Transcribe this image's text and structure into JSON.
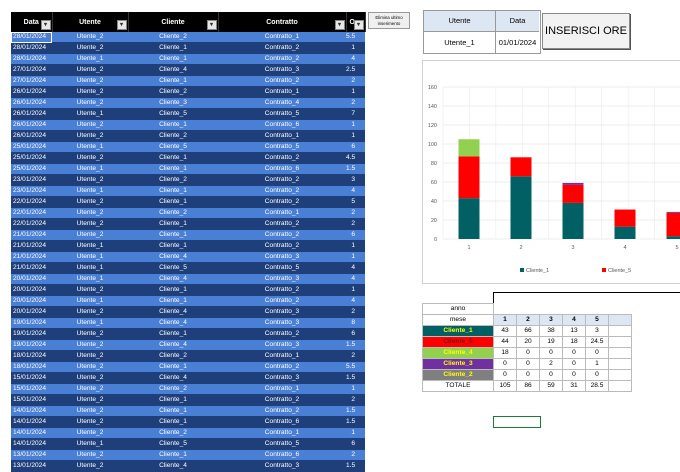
{
  "columns": [
    "Data",
    "Utente",
    "Cliente",
    "Contratto",
    "Ore"
  ],
  "rows": [
    [
      "28/01/2024",
      "Utente_2",
      "Cliente_2",
      "Contratto_1",
      "5.5"
    ],
    [
      "28/01/2024",
      "Utente_2",
      "Cliente_1",
      "Contratto_2",
      "1"
    ],
    [
      "28/01/2024",
      "Utente_1",
      "Cliente_1",
      "Contratto_2",
      "4"
    ],
    [
      "27/01/2024",
      "Utente_2",
      "Cliente_4",
      "Contratto_3",
      "2.5"
    ],
    [
      "27/01/2024",
      "Utente_2",
      "Cliente_1",
      "Contratto_2",
      "2"
    ],
    [
      "26/01/2024",
      "Utente_2",
      "Cliente_2",
      "Contratto_1",
      "1"
    ],
    [
      "26/01/2024",
      "Utente_2",
      "Cliente_3",
      "Contratto_4",
      "2"
    ],
    [
      "26/01/2024",
      "Utente_1",
      "Cliente_5",
      "Contratto_5",
      "7"
    ],
    [
      "26/01/2024",
      "Utente_2",
      "Cliente_1",
      "Contratto_6",
      "1"
    ],
    [
      "26/01/2024",
      "Utente_2",
      "Cliente_2",
      "Contratto_1",
      "1"
    ],
    [
      "25/01/2024",
      "Utente_1",
      "Cliente_5",
      "Contratto_5",
      "6"
    ],
    [
      "25/01/2024",
      "Utente_2",
      "Cliente_1",
      "Contratto_2",
      "4.5"
    ],
    [
      "25/01/2024",
      "Utente_1",
      "Cliente_1",
      "Contratto_6",
      "1.5"
    ],
    [
      "23/01/2024",
      "Utente_2",
      "Cliente_2",
      "Contratto_2",
      "3"
    ],
    [
      "23/01/2024",
      "Utente_1",
      "Cliente_1",
      "Contratto_2",
      "4"
    ],
    [
      "22/01/2024",
      "Utente_2",
      "Cliente_1",
      "Contratto_2",
      "5"
    ],
    [
      "22/01/2024",
      "Utente_2",
      "Cliente_2",
      "Contratto_1",
      "2"
    ],
    [
      "22/01/2024",
      "Utente_2",
      "Cliente_1",
      "Contratto_2",
      "2"
    ],
    [
      "21/01/2024",
      "Utente_2",
      "Cliente_1",
      "Contratto_2",
      "6"
    ],
    [
      "21/01/2024",
      "Utente_1",
      "Cliente_1",
      "Contratto_2",
      "1"
    ],
    [
      "21/01/2024",
      "Utente_1",
      "Cliente_4",
      "Contratto_3",
      "1"
    ],
    [
      "21/01/2024",
      "Utente_1",
      "Cliente_5",
      "Contratto_5",
      "4"
    ],
    [
      "20/01/2024",
      "Utente_1",
      "Cliente_4",
      "Contratto_3",
      "4"
    ],
    [
      "20/01/2024",
      "Utente_2",
      "Cliente_1",
      "Contratto_2",
      "1"
    ],
    [
      "20/01/2024",
      "Utente_1",
      "Cliente_1",
      "Contratto_2",
      "4"
    ],
    [
      "20/01/2024",
      "Utente_2",
      "Cliente_4",
      "Contratto_3",
      "2"
    ],
    [
      "19/01/2024",
      "Utente_1",
      "Cliente_4",
      "Contratto_3",
      "8"
    ],
    [
      "19/01/2024",
      "Utente_2",
      "Cliente_1",
      "Contratto_2",
      "6"
    ],
    [
      "19/01/2024",
      "Utente_2",
      "Cliente_4",
      "Contratto_3",
      "1.5"
    ],
    [
      "18/01/2024",
      "Utente_2",
      "Cliente_2",
      "Contratto_1",
      "2"
    ],
    [
      "18/01/2024",
      "Utente_2",
      "Cliente_1",
      "Contratto_2",
      "5.5"
    ],
    [
      "15/01/2024",
      "Utente_2",
      "Cliente_4",
      "Contratto_3",
      "1.5"
    ],
    [
      "15/01/2024",
      "Utente_2",
      "Cliente_2",
      "Contratto_1",
      "1"
    ],
    [
      "15/01/2024",
      "Utente_2",
      "Cliente_1",
      "Contratto_2",
      "2"
    ],
    [
      "14/01/2024",
      "Utente_2",
      "Cliente_1",
      "Contratto_2",
      "1.5"
    ],
    [
      "14/01/2024",
      "Utente_2",
      "Cliente_1",
      "Contratto_6",
      "1.5"
    ],
    [
      "14/01/2024",
      "Utente_2",
      "Cliente_2",
      "Contratto_1",
      "1"
    ],
    [
      "14/01/2024",
      "Utente_1",
      "Cliente_5",
      "Contratto_5",
      "6"
    ],
    [
      "13/01/2024",
      "Utente_2",
      "Cliente_1",
      "Contratto_6",
      "2"
    ],
    [
      "13/01/2024",
      "Utente_2",
      "Cliente_4",
      "Contratto_3",
      "1.5"
    ]
  ],
  "delete_button": "Elimina ultimo inserimento",
  "user_box": {
    "utente_label": "Utente",
    "data_label": "Data",
    "utente_value": "Utente_1",
    "data_value": "01/01/2024"
  },
  "insert_button": "INSERISCI ORE",
  "chart_data": {
    "type": "bar",
    "stacked": true,
    "categories": [
      "1",
      "2",
      "3",
      "4",
      "5"
    ],
    "ylim": [
      0,
      160
    ],
    "yticks": [
      0,
      20,
      40,
      60,
      80,
      100,
      120,
      140,
      160
    ],
    "grid": true,
    "legend_position": "bottom",
    "series": [
      {
        "name": "Cliente_1",
        "color": "#006064",
        "values": [
          43,
          66,
          38,
          13,
          3
        ]
      },
      {
        "name": "Cliente_5",
        "color": "#ff0000",
        "values": [
          44,
          20,
          19,
          18,
          24.5
        ]
      },
      {
        "color": "#92d050",
        "values": [
          18,
          0,
          0,
          0,
          0
        ]
      },
      {
        "color": "#7030a0",
        "values": [
          0,
          0,
          2,
          0,
          1
        ]
      },
      {
        "color": "#7f7f7f",
        "values": [
          0,
          0,
          0,
          0,
          0
        ]
      }
    ]
  },
  "summary": {
    "anno_label": "anno",
    "mese_label": "mese",
    "months": [
      "1",
      "2",
      "3",
      "4",
      "5"
    ],
    "rows": [
      {
        "name": "Cliente_1",
        "bg": "#006064",
        "fg": "#ffff00",
        "values": [
          "43",
          "66",
          "38",
          "13",
          "3"
        ]
      },
      {
        "name": "Cliente_5",
        "bg": "#ff0000",
        "fg": "#7f1010",
        "values": [
          "44",
          "20",
          "19",
          "18",
          "24.5"
        ]
      },
      {
        "name": "Cliente_4",
        "bg": "#92d050",
        "fg": "#ffff00",
        "values": [
          "18",
          "0",
          "0",
          "0",
          "0"
        ]
      },
      {
        "name": "Cliente_3",
        "bg": "#7030a0",
        "fg": "#ffff00",
        "values": [
          "0",
          "0",
          "2",
          "0",
          "1"
        ]
      },
      {
        "name": "Cliente_2",
        "bg": "#7f7f7f",
        "fg": "#ffff00",
        "values": [
          "0",
          "0",
          "0",
          "0",
          "0"
        ]
      }
    ],
    "total_label": "TOTALE",
    "totals": [
      "105",
      "86",
      "59",
      "31",
      "28.5"
    ]
  }
}
